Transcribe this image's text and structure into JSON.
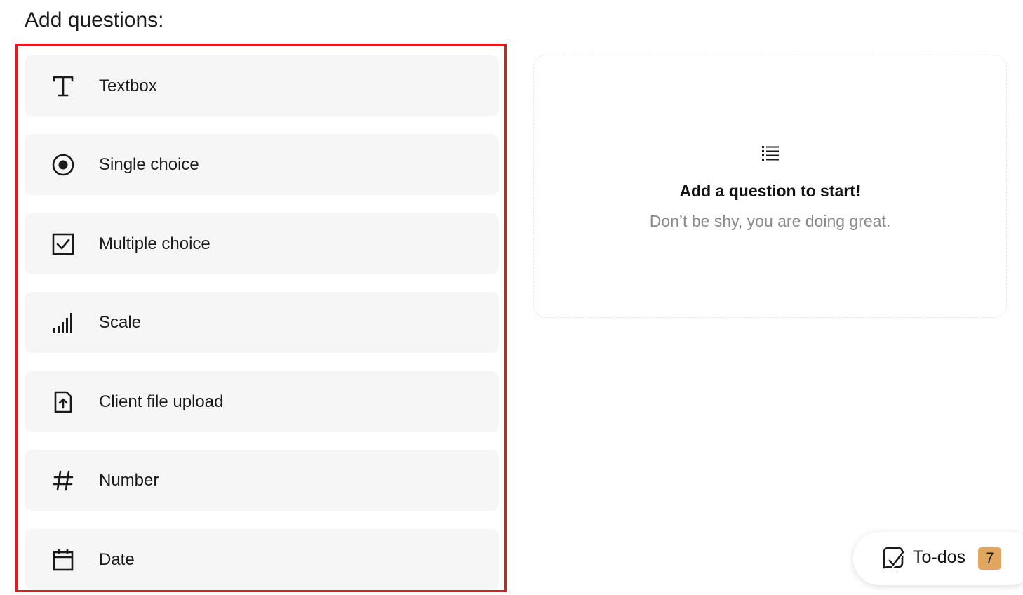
{
  "section_title": "Add questions:",
  "question_types": [
    {
      "label": "Textbox",
      "icon": "text-icon"
    },
    {
      "label": "Single choice",
      "icon": "radio-icon"
    },
    {
      "label": "Multiple choice",
      "icon": "checkbox-icon"
    },
    {
      "label": "Scale",
      "icon": "scale-icon"
    },
    {
      "label": "Client file upload",
      "icon": "file-upload-icon"
    },
    {
      "label": "Number",
      "icon": "hash-icon"
    },
    {
      "label": "Date",
      "icon": "calendar-icon"
    }
  ],
  "empty_state": {
    "icon": "list-icon",
    "title": "Add a question to start!",
    "subtitle": "Don’t be shy, you are doing great."
  },
  "todos": {
    "label": "To-dos",
    "count": "7",
    "icon": "todo-check-icon"
  },
  "colors": {
    "highlight_border": "#e31b1b",
    "item_background": "#f6f6f6",
    "badge": "#e0a55e",
    "muted_text": "#8a8a8a"
  }
}
